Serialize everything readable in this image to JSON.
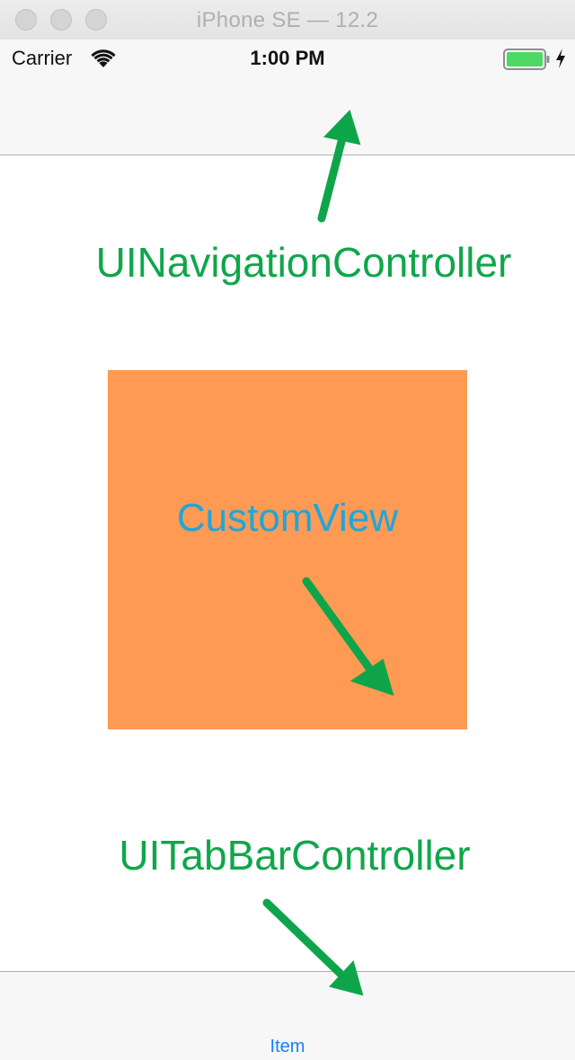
{
  "window": {
    "title": "iPhone SE — 12.2"
  },
  "status_bar": {
    "carrier": "Carrier",
    "time": "1:00 PM",
    "wifi_icon": "wifi-icon",
    "battery_icon": "battery-charging-icon"
  },
  "content": {
    "nav_label": "UINavigationController",
    "custom_view_label": "CustomView",
    "tab_label": "UITabBarController"
  },
  "tab_bar": {
    "items": [
      {
        "label": "Item"
      }
    ]
  },
  "colors": {
    "annotation_green": "#10a64b",
    "arrow_green": "#0ea54a",
    "custom_view_bg": "#fe9a53",
    "custom_view_text": "#1ea6dc",
    "tab_tint": "#147efb",
    "bar_bg": "#f7f7f7"
  }
}
